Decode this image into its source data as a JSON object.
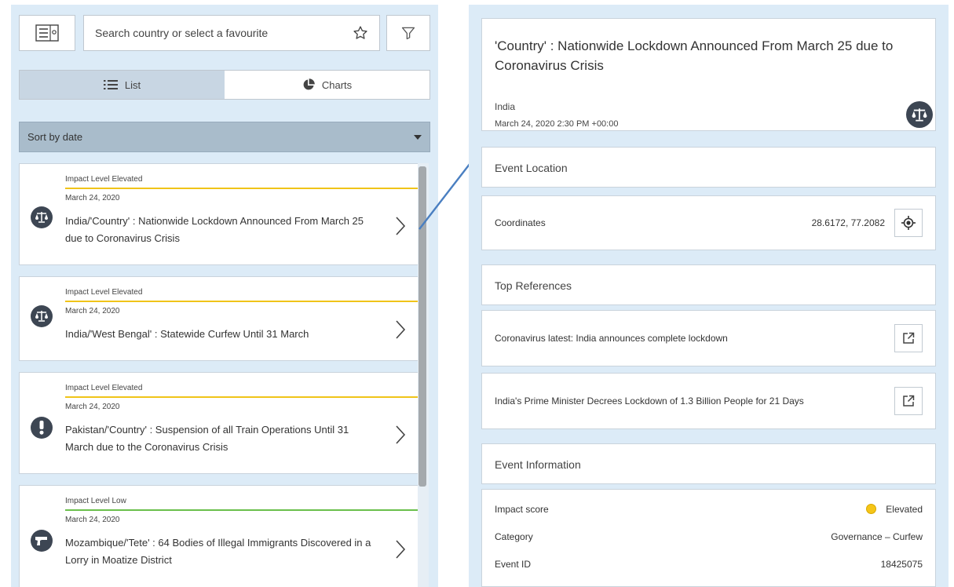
{
  "search": {
    "placeholder": "Search country or select a favourite"
  },
  "view_tabs": [
    {
      "label": "List",
      "active": true
    },
    {
      "label": "Charts",
      "active": false
    }
  ],
  "sort": {
    "selected": "Sort by date"
  },
  "events": [
    {
      "impact": "Impact Level Elevated",
      "impact_color": "#f0c419",
      "date": "March 24, 2020",
      "title": "India/'Country' : Nationwide Lockdown Announced From March 25 due to Coronavirus Crisis",
      "icon": "scales-icon"
    },
    {
      "impact": "Impact Level Elevated",
      "impact_color": "#f0c419",
      "date": "March 24, 2020",
      "title": "India/'West Bengal' : Statewide Curfew Until 31 March",
      "icon": "scales-icon"
    },
    {
      "impact": "Impact Level Elevated",
      "impact_color": "#f0c419",
      "date": "March 24, 2020",
      "title": "Pakistan/'Country' : Suspension of all Train Operations Until 31 March due to the Coronavirus Crisis",
      "icon": "exclamation-icon"
    },
    {
      "impact": "Impact Level Low",
      "impact_color": "#6abf4b",
      "date": "March 24, 2020",
      "title": "Mozambique/'Tete' : 64 Bodies of Illegal Immigrants Discovered in a Lorry in Moatize District",
      "icon": "gun-icon"
    }
  ],
  "detail": {
    "title": "'Country' : Nationwide Lockdown Announced From March 25 due to Coronavirus Crisis",
    "country": "India",
    "timestamp": "March 24, 2020 2:30 PM +00:00",
    "category_icon": "scales-icon",
    "location": {
      "heading": "Event Location",
      "coords_label": "Coordinates",
      "coords_value": "28.6172, 77.2082"
    },
    "references": {
      "heading": "Top References",
      "items": [
        "Coronavirus latest: India announces complete lockdown",
        "India's Prime Minister Decrees Lockdown of 1.3 Billion People for 21 Days"
      ]
    },
    "info": {
      "heading": "Event Information",
      "impact_label": "Impact score",
      "impact_value": "Elevated",
      "impact_color": "#f5c518",
      "category_label": "Category",
      "category_value": "Governance – Curfew",
      "event_id_label": "Event ID",
      "event_id_value": "18425075"
    }
  }
}
